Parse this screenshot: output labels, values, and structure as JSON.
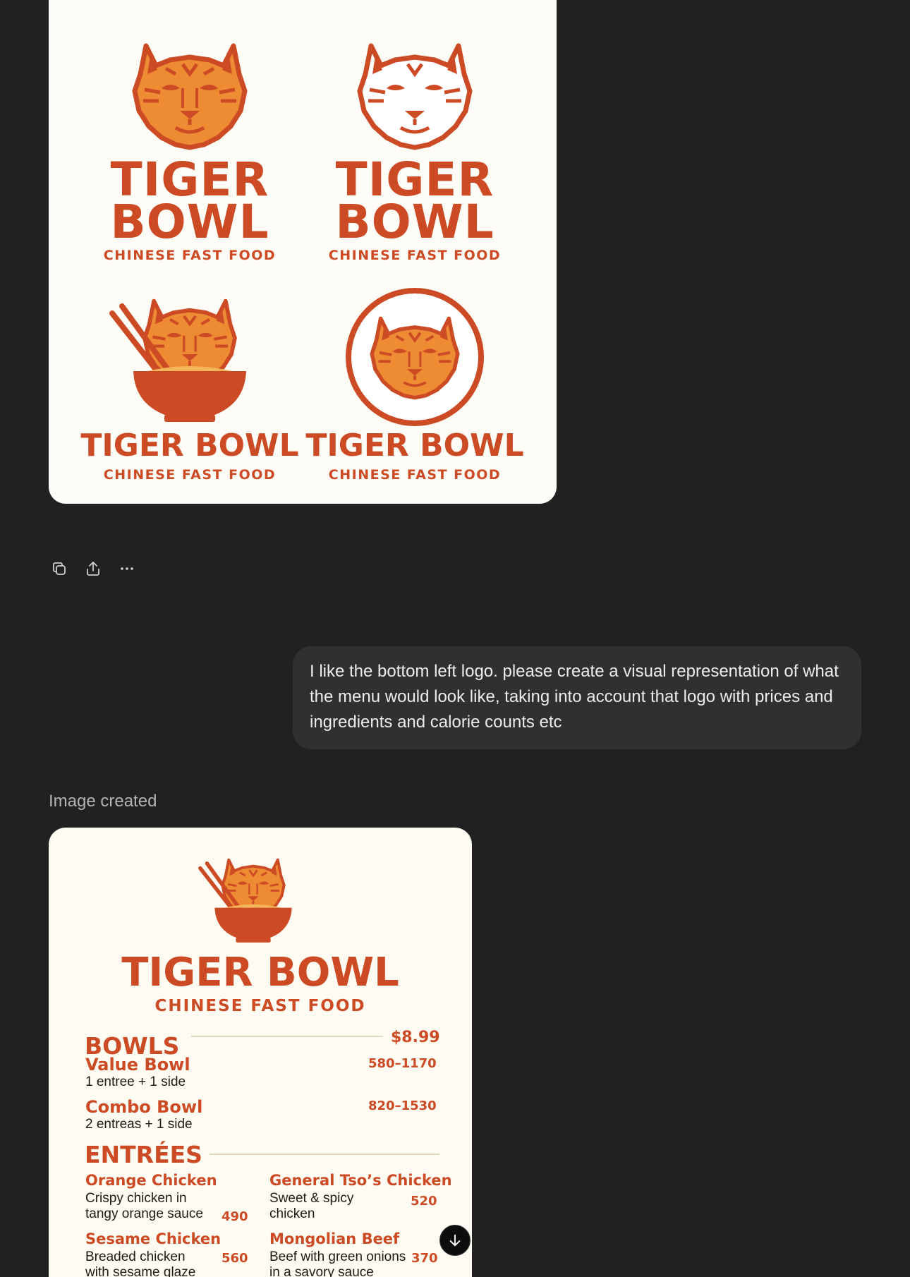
{
  "logo_sheet": {
    "variants": [
      {
        "line1": "TIGER",
        "line2": "BOWL",
        "tagline": "CHINESE FAST FOOD"
      },
      {
        "line1": "TIGER",
        "line2": "BOWL",
        "tagline": "CHINESE FAST FOOD"
      },
      {
        "brand": "TIGER BOWL",
        "tagline": "CHINESE FAST FOOD"
      },
      {
        "brand": "TIGER BOWL",
        "tagline": "CHINESE FAST FOOD"
      }
    ]
  },
  "actions": [
    "copy-icon",
    "share-icon",
    "more-icon"
  ],
  "user_message": "I like the bottom left logo. please create a visual representation of what the menu would look like, taking into account that logo with prices and ingredients and calorie counts etc",
  "status": "Image created",
  "menu": {
    "brand": "TIGER BOWL",
    "tagline": "CHINESE FAST FOOD",
    "bowls": {
      "heading": "BOWLS",
      "price": "$8.99",
      "items": [
        {
          "name": "Value Bowl",
          "desc": "1 entree + 1 side",
          "cal": "580–1170"
        },
        {
          "name": "Combo Bowl",
          "desc": "2 entreas + 1 side",
          "cal": "820–1530"
        }
      ]
    },
    "entrees": {
      "heading": "ENTRÉES",
      "items": [
        {
          "name": "Orange Chicken",
          "desc1": "Crispy chicken in",
          "desc2": "tangy orange sauce",
          "cal": "490"
        },
        {
          "name": "General Tso’s Chicken",
          "desc1": "Sweet & spicy",
          "desc2": "chicken",
          "cal": "520"
        },
        {
          "name": "Sesame Chicken",
          "desc1": "Breaded chicken",
          "desc2": "with sesame glaze",
          "cal": "560"
        },
        {
          "name": "Mongolian Beef",
          "desc1": "Beef with green onions",
          "desc2": "in a savory sauce",
          "cal": "370"
        }
      ]
    }
  },
  "colors": {
    "background": "#212121",
    "bubble": "#303030",
    "brand": "#cc4a24",
    "tiger": "#ee8c34",
    "card": "#fdfcf6"
  }
}
